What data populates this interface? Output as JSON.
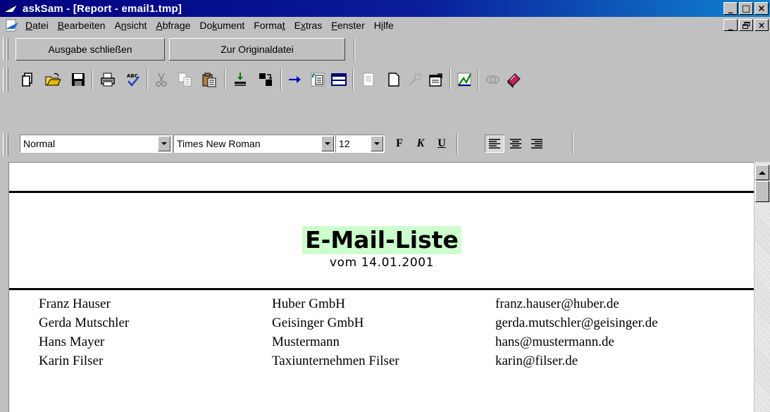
{
  "window": {
    "title": "askSam - [Report - email1.tmp]",
    "title_gradient_start": "#000080",
    "title_gradient_end": "#1084d0",
    "buttons": {
      "minimize": "_",
      "maximize": "□",
      "close": "×"
    }
  },
  "menu": {
    "items": [
      {
        "label": "Datei",
        "mnemonic_index": 0
      },
      {
        "label": "Bearbeiten",
        "mnemonic_index": 0
      },
      {
        "label": "Ansicht",
        "mnemonic_index": 1
      },
      {
        "label": "Abfrage",
        "mnemonic_index": 0
      },
      {
        "label": "Dokument",
        "mnemonic_index": 2
      },
      {
        "label": "Format",
        "mnemonic_index": 5
      },
      {
        "label": "Extras",
        "mnemonic_index": 1
      },
      {
        "label": "Fenster",
        "mnemonic_index": 0
      },
      {
        "label": "Hilfe",
        "mnemonic_index": 1
      }
    ],
    "mdi_buttons": {
      "minimize": "_",
      "restore": "🗗",
      "close": "×"
    }
  },
  "report_toolbar": {
    "close_output_label": "Ausgabe schließen",
    "to_original_label": "Zur Originaldatei"
  },
  "standard_toolbar": {
    "icons": [
      "new-document-icon",
      "open-folder-icon",
      "save-disk-icon",
      "print-icon",
      "spellcheck-icon",
      "cut-icon",
      "copy-icon",
      "paste-icon",
      "import-icon",
      "export-icon",
      "arrow-right-icon",
      "document-view-icon",
      "table-view-icon",
      "page-icon",
      "blank-page-icon",
      "pin-icon",
      "properties-icon",
      "chart-icon",
      "link-icon",
      "book-icon"
    ]
  },
  "format_toolbar": {
    "style": "Normal",
    "font": "Times New Roman",
    "size": "12",
    "bold": "F",
    "italic": "K",
    "underline": "U",
    "alignment": "left"
  },
  "report": {
    "title": "E-Mail-Liste",
    "date": "vom 14.01.2001",
    "title_highlight": "#ccffcc",
    "entries": [
      {
        "name": "Franz Hauser",
        "company": "Huber GmbH",
        "email": "franz.hauser@huber.de"
      },
      {
        "name": "Gerda Mutschler",
        "company": "Geisinger GmbH",
        "email": "gerda.mutschler@geisinger.de"
      },
      {
        "name": "Hans Mayer",
        "company": "Mustermann",
        "email": "hans@mustermann.de"
      },
      {
        "name": "Karin Filser",
        "company": "Taxiunternehmen Filser",
        "email": "karin@filser.de"
      }
    ]
  }
}
